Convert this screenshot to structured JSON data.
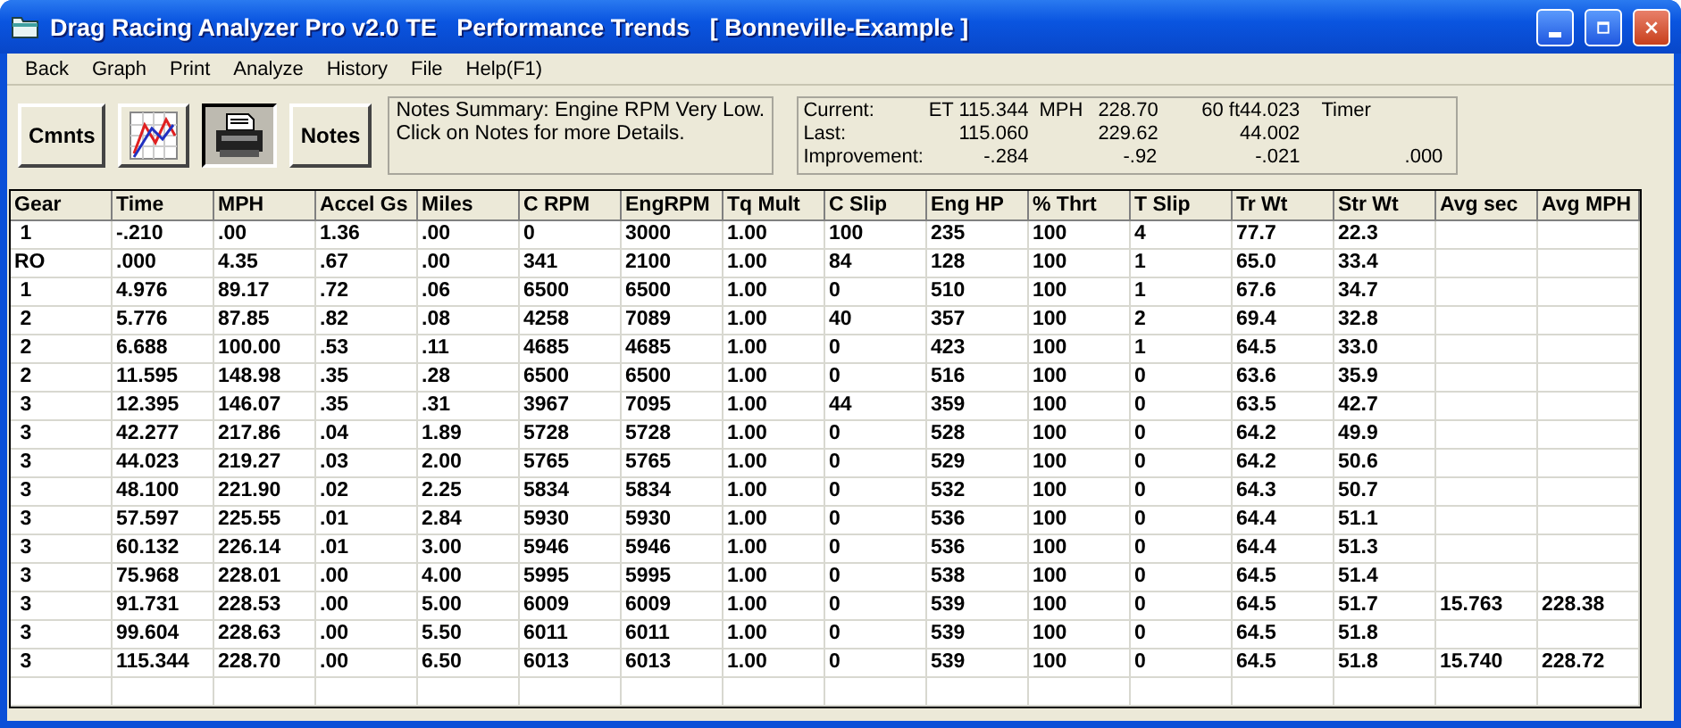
{
  "window": {
    "title": "Drag Racing Analyzer Pro v2.0 TE   Performance Trends   [ Bonneville-Example ]"
  },
  "menu": [
    "Back",
    "Graph",
    "Print",
    "Analyze",
    "History",
    "File",
    "Help(F1)"
  ],
  "toolbar": [
    {
      "kind": "text",
      "label": "Cmnts",
      "pressed": false
    },
    {
      "kind": "graph",
      "pressed": false
    },
    {
      "kind": "printer",
      "pressed": true
    },
    {
      "kind": "text",
      "label": "Notes",
      "pressed": false
    }
  ],
  "notes_summary": {
    "lines": [
      "Notes Summary:  Engine RPM Very Low.",
      "Click on Notes for more Details."
    ]
  },
  "results": [
    {
      "label": "Current:",
      "et": "ET 115.344",
      "mph_label": "MPH",
      "mph": "228.70",
      "sixty": "60 ft44.023",
      "timer_label": "Timer"
    },
    {
      "label": "Last:",
      "et": "115.060",
      "mph": "229.62",
      "sixty": "44.002"
    },
    {
      "label": "Improvement:",
      "et": "-.284",
      "mph": "-.92",
      "sixty": "-.021",
      "timer": ".000"
    }
  ],
  "table": {
    "columns": [
      "Gear",
      "Time",
      "MPH",
      "Accel Gs",
      "Miles",
      "C RPM",
      "EngRPM",
      "Tq Mult",
      "C Slip",
      "Eng HP",
      "% Thrt",
      "T Slip",
      "Tr Wt",
      "Str Wt",
      "Avg sec",
      "Avg MPH"
    ],
    "rows": [
      [
        " 1",
        "-.210",
        ".00",
        "1.36",
        ".00",
        "0",
        "3000",
        "1.00",
        "100",
        "235",
        "100",
        "4",
        "77.7",
        "22.3",
        null,
        null
      ],
      [
        "RO",
        ".000",
        "4.35",
        ".67",
        ".00",
        "341",
        "2100",
        "1.00",
        "84",
        "128",
        "100",
        "1",
        "65.0",
        "33.4",
        null,
        null
      ],
      [
        " 1",
        "4.976",
        "89.17",
        ".72",
        ".06",
        "6500",
        "6500",
        "1.00",
        "0",
        "510",
        "100",
        "1",
        "67.6",
        "34.7",
        null,
        null
      ],
      [
        " 2",
        "5.776",
        "87.85",
        ".82",
        ".08",
        "4258",
        "7089",
        "1.00",
        "40",
        "357",
        "100",
        "2",
        "69.4",
        "32.8",
        null,
        null
      ],
      [
        " 2",
        "6.688",
        "100.00",
        ".53",
        ".11",
        "4685",
        "4685",
        "1.00",
        "0",
        "423",
        "100",
        "1",
        "64.5",
        "33.0",
        null,
        null
      ],
      [
        " 2",
        "11.595",
        "148.98",
        ".35",
        ".28",
        "6500",
        "6500",
        "1.00",
        "0",
        "516",
        "100",
        "0",
        "63.6",
        "35.9",
        null,
        null
      ],
      [
        " 3",
        "12.395",
        "146.07",
        ".35",
        ".31",
        "3967",
        "7095",
        "1.00",
        "44",
        "359",
        "100",
        "0",
        "63.5",
        "42.7",
        null,
        null
      ],
      [
        " 3",
        "42.277",
        "217.86",
        ".04",
        "1.89",
        "5728",
        "5728",
        "1.00",
        "0",
        "528",
        "100",
        "0",
        "64.2",
        "49.9",
        null,
        null
      ],
      [
        " 3",
        "44.023",
        "219.27",
        ".03",
        "2.00",
        "5765",
        "5765",
        "1.00",
        "0",
        "529",
        "100",
        "0",
        "64.2",
        "50.6",
        null,
        null
      ],
      [
        " 3",
        "48.100",
        "221.90",
        ".02",
        "2.25",
        "5834",
        "5834",
        "1.00",
        "0",
        "532",
        "100",
        "0",
        "64.3",
        "50.7",
        null,
        null
      ],
      [
        " 3",
        "57.597",
        "225.55",
        ".01",
        "2.84",
        "5930",
        "5930",
        "1.00",
        "0",
        "536",
        "100",
        "0",
        "64.4",
        "51.1",
        null,
        null
      ],
      [
        " 3",
        "60.132",
        "226.14",
        ".01",
        "3.00",
        "5946",
        "5946",
        "1.00",
        "0",
        "536",
        "100",
        "0",
        "64.4",
        "51.3",
        null,
        null
      ],
      [
        " 3",
        "75.968",
        "228.01",
        ".00",
        "4.00",
        "5995",
        "5995",
        "1.00",
        "0",
        "538",
        "100",
        "0",
        "64.5",
        "51.4",
        null,
        null
      ],
      [
        " 3",
        "91.731",
        "228.53",
        ".00",
        "5.00",
        "6009",
        "6009",
        "1.00",
        "0",
        "539",
        "100",
        "0",
        "64.5",
        "51.7",
        "15.763",
        "228.38"
      ],
      [
        " 3",
        "99.604",
        "228.63",
        ".00",
        "5.50",
        "6011",
        "6011",
        "1.00",
        "0",
        "539",
        "100",
        "0",
        "64.5",
        "51.8",
        null,
        null
      ],
      [
        " 3",
        "115.344",
        "228.70",
        ".00",
        "6.50",
        "6013",
        "6013",
        "1.00",
        "0",
        "539",
        "100",
        "0",
        "64.5",
        "51.8",
        "15.740",
        "228.72"
      ]
    ]
  }
}
